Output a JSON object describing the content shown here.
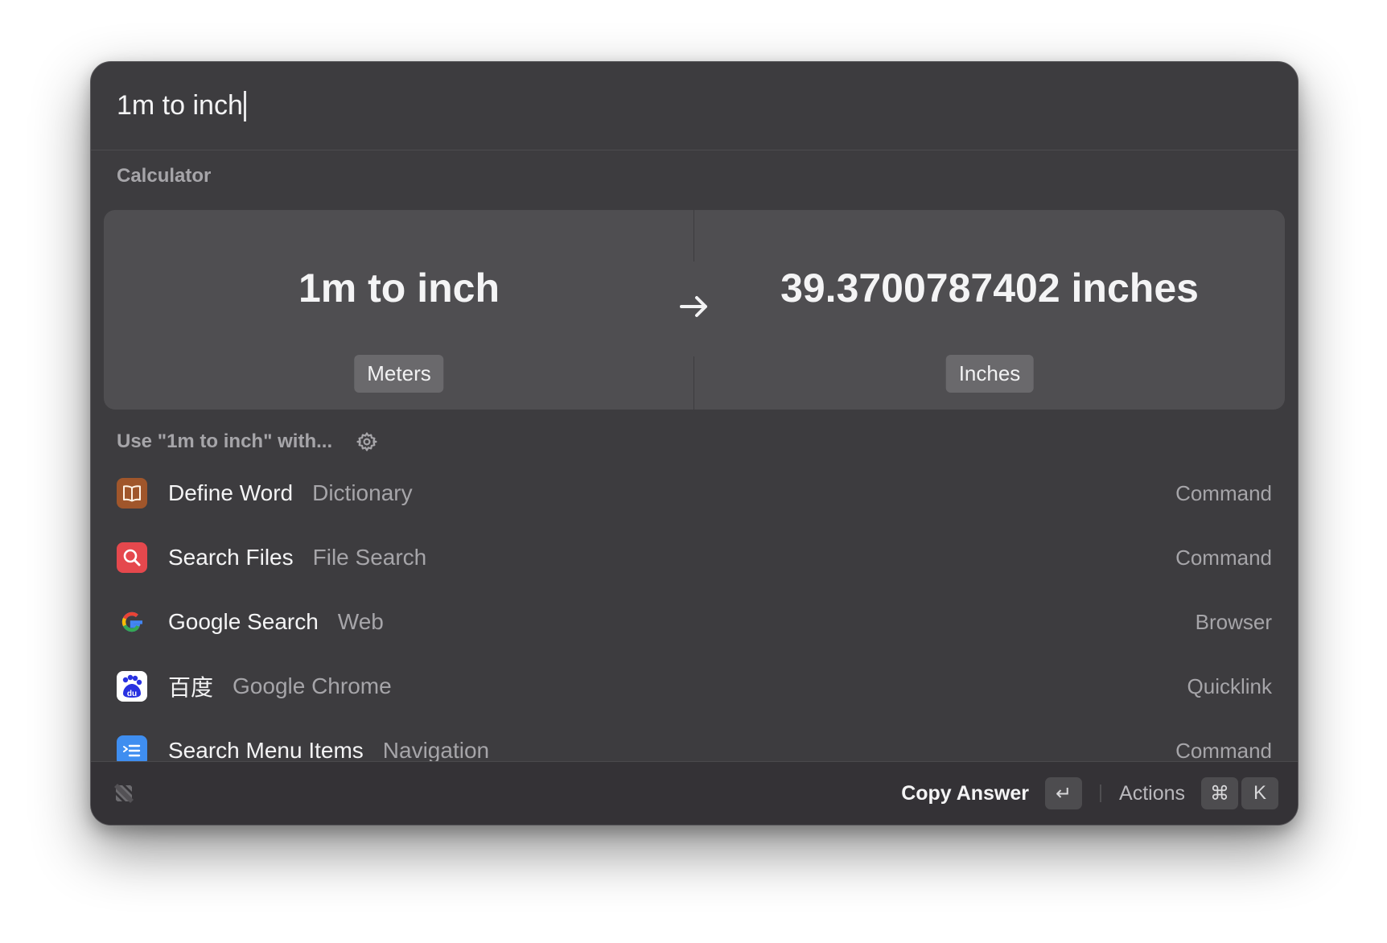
{
  "search": {
    "query": "1m to inch"
  },
  "calculator": {
    "section_label": "Calculator",
    "input_value": "1m to inch",
    "input_unit": "Meters",
    "result_value": "39.3700787402 inches",
    "result_unit": "Inches",
    "arrow_icon": "arrow-right-icon"
  },
  "use_with": {
    "label": "Use \"1m to inch\" with...",
    "icon": "gear-icon"
  },
  "results": [
    {
      "title": "Define Word",
      "subtitle": "Dictionary",
      "type": "Command",
      "icon": "dictionary-book-icon",
      "color": "#a0562b"
    },
    {
      "title": "Search Files",
      "subtitle": "File Search",
      "type": "Command",
      "icon": "file-search-icon",
      "color": "#e5484d"
    },
    {
      "title": "Google Search",
      "subtitle": "Web",
      "type": "Browser",
      "icon": "google-icon",
      "color": "#ffffff"
    },
    {
      "title": "百度",
      "subtitle": "Google Chrome",
      "type": "Quicklink",
      "icon": "baidu-icon",
      "color": "#2932e1"
    },
    {
      "title": "Search Menu Items",
      "subtitle": "Navigation",
      "type": "Command",
      "icon": "menu-items-icon",
      "color": "#3f8ef0"
    }
  ],
  "footer": {
    "primary_action": "Copy Answer",
    "primary_key": "↵",
    "secondary_action": "Actions",
    "secondary_keys": [
      "⌘",
      "K"
    ],
    "logo_icon": "raycast-logo-icon"
  }
}
